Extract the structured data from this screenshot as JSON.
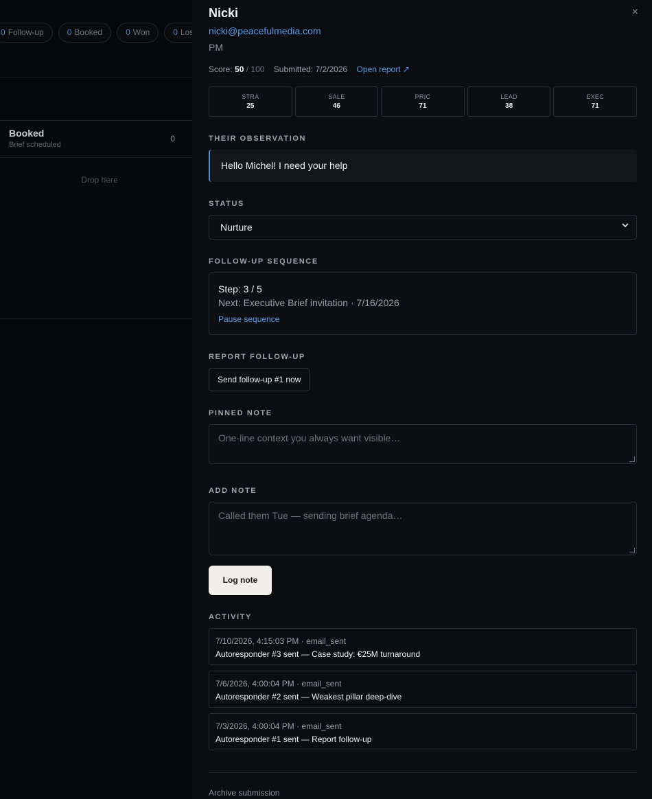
{
  "board": {
    "pills": [
      {
        "count": "0",
        "label": "Follow-up"
      },
      {
        "count": "0",
        "label": "Booked"
      },
      {
        "count": "0",
        "label": "Won"
      },
      {
        "count": "0",
        "label": "Los"
      }
    ],
    "column": {
      "title": "Booked",
      "subtitle": "Brief scheduled",
      "count": "0",
      "drop": "Drop here"
    }
  },
  "drawer": {
    "close_icon": "×",
    "name": "Nicki",
    "email": "nicki@peacefulmedia.com",
    "role": "PM",
    "score_label": "Score:",
    "score_value": "50",
    "score_max": "/ 100",
    "submitted": "Submitted: 7/2/2026",
    "open_report": "Open report ↗",
    "scores": [
      {
        "label": "STRA",
        "value": "25"
      },
      {
        "label": "SALE",
        "value": "46"
      },
      {
        "label": "PRIC",
        "value": "71"
      },
      {
        "label": "LEAD",
        "value": "38"
      },
      {
        "label": "EXEC",
        "value": "71"
      }
    ],
    "observation_heading": "THEIR OBSERVATION",
    "observation": "Hello Michel! I need your help",
    "status_heading": "STATUS",
    "status_value": "Nurture",
    "sequence_heading": "FOLLOW-UP SEQUENCE",
    "sequence_step": "Step: 3 / 5",
    "sequence_next": "Next: Executive Brief invitation · 7/16/2026",
    "sequence_pause": "Pause sequence",
    "report_heading": "REPORT FOLLOW-UP",
    "report_button": "Send follow-up #1 now",
    "pinned_heading": "PINNED NOTE",
    "pinned_placeholder": "One-line context you always want visible…",
    "note_heading": "ADD NOTE",
    "note_placeholder": "Called them Tue — sending brief agenda…",
    "log_button": "Log note",
    "activity_heading": "ACTIVITY",
    "activity": [
      {
        "when": "7/10/2026, 4:15:03 PM · email_sent",
        "what": "Autoresponder #3 sent — Case study: €25M turnaround"
      },
      {
        "when": "7/6/2026, 4:00:04 PM · email_sent",
        "what": "Autoresponder #2 sent — Weakest pillar deep-dive"
      },
      {
        "when": "7/3/2026, 4:00:04 PM · email_sent",
        "what": "Autoresponder #1 sent — Report follow-up"
      }
    ],
    "archive": "Archive submission"
  }
}
